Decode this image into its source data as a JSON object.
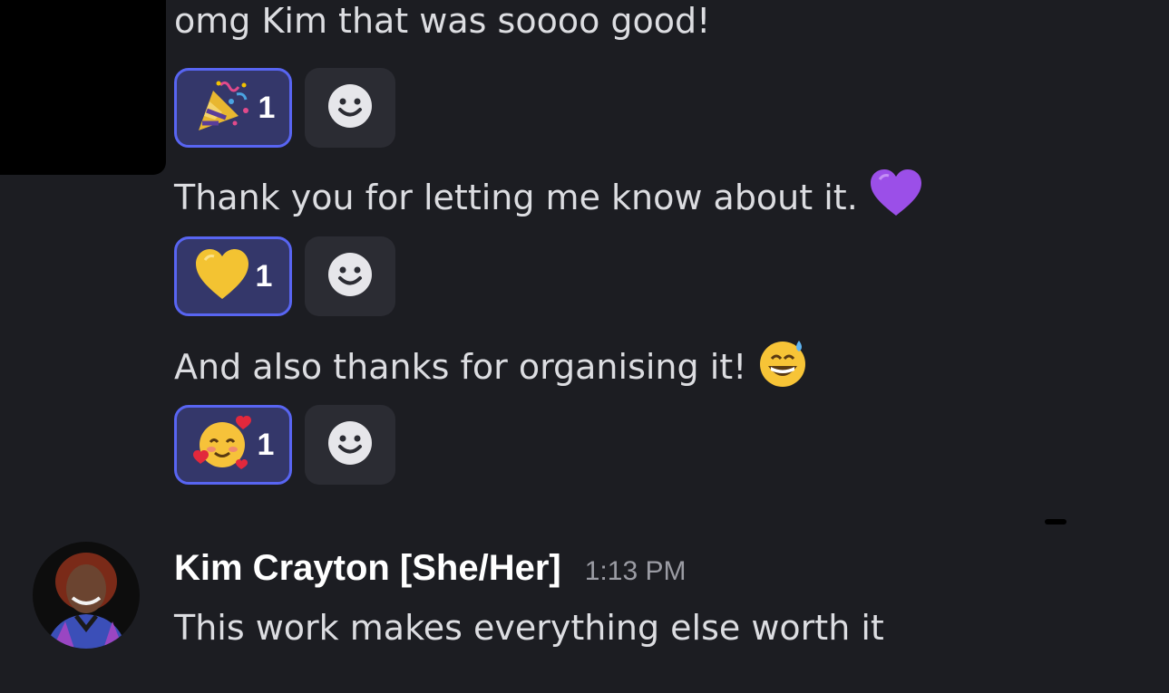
{
  "colors": {
    "background": "#1c1d22",
    "text": "#dcdde1",
    "reaction_border": "#5865f2",
    "reaction_fill": "#34376a",
    "add_reaction_fill": "#2b2c33"
  },
  "messages": [
    {
      "text": "omg Kim that was soooo good!",
      "trailing_emoji": "",
      "reaction": {
        "emoji": "party-popper",
        "count": "1"
      }
    },
    {
      "text": "Thank you for letting me know about it.",
      "trailing_emoji": "purple-heart",
      "reaction": {
        "emoji": "yellow-heart",
        "count": "1"
      }
    },
    {
      "text": "And also thanks for organising it!",
      "trailing_emoji": "grinning-face-with-sweat",
      "reaction": {
        "emoji": "smiling-face-with-hearts",
        "count": "1"
      }
    }
  ],
  "latest_message": {
    "author": "Kim Crayton [She/Her]",
    "timestamp": "1:13 PM",
    "text": "This work makes everything else worth it"
  }
}
